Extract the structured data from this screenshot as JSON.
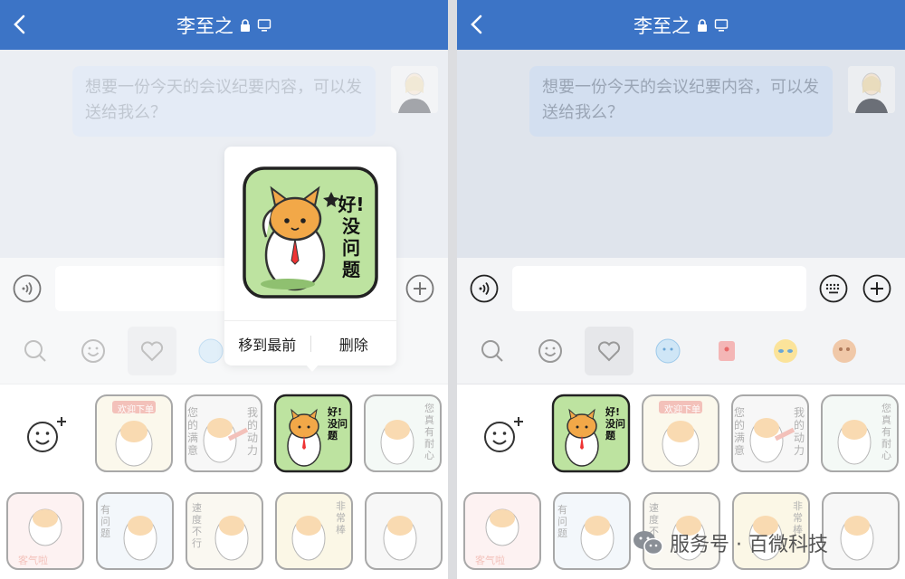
{
  "header": {
    "title": "李至之"
  },
  "chat": {
    "message": "想要一份今天的会议纪要内容，可以发送给我么？"
  },
  "popup": {
    "move_to_front": "移到最前",
    "delete": "删除"
  },
  "sticker_text": {
    "ok": "好!没问题",
    "welcome": "欢迎下单",
    "satisfaction": "您的满意",
    "motivation": "我的动力",
    "polite": "客气啦",
    "question": "有问题",
    "speed": "速度不行",
    "great": "非常棒",
    "patience": "您真有耐心"
  },
  "watermark": {
    "text": "服务号 · 百微科技"
  },
  "colors": {
    "header": "#3c74c6",
    "sticker_green": "#bde3a0",
    "cat_orange": "#f2a848"
  },
  "icons": [
    "back-arrow-icon",
    "lock-icon",
    "desktop-icon",
    "voice-icon",
    "keyboard-icon",
    "plus-icon",
    "search-icon",
    "emoji-icon",
    "heart-icon",
    "add-sticker-icon",
    "wechat-icon"
  ]
}
